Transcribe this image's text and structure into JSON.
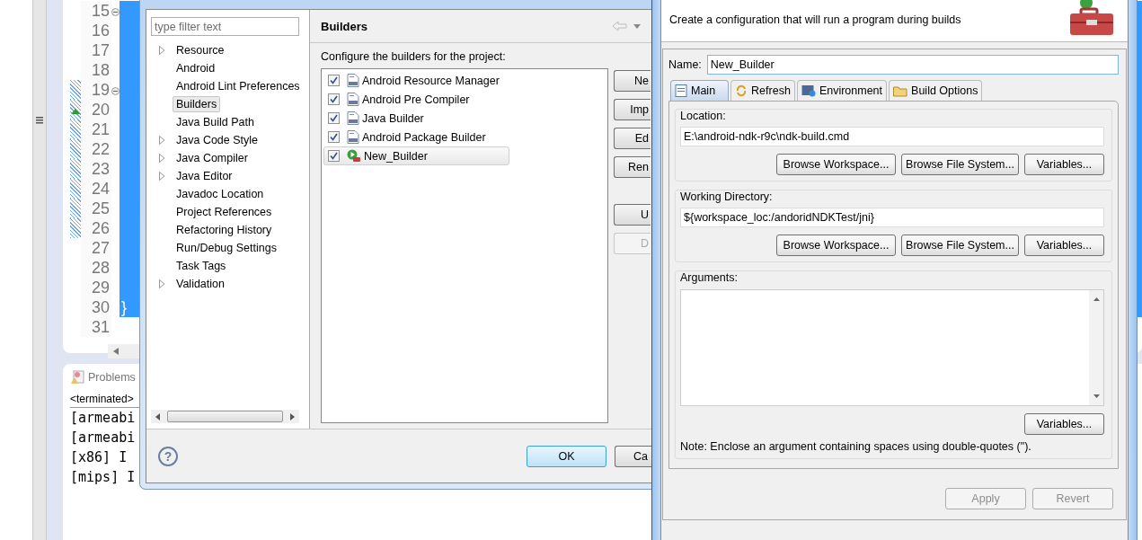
{
  "editor": {
    "lines": [
      {
        "number": "15",
        "kind": "fold",
        "selected": true,
        "changed": false
      },
      {
        "number": "16",
        "kind": "plain",
        "selected": true,
        "changed": false
      },
      {
        "number": "17",
        "kind": "plain",
        "selected": true,
        "changed": false
      },
      {
        "number": "18",
        "kind": "plain",
        "selected": true,
        "changed": false
      },
      {
        "number": "19",
        "kind": "fold",
        "selected": true,
        "changed": true
      },
      {
        "number": "20",
        "kind": "marker",
        "selected": true,
        "changed": true
      },
      {
        "number": "21",
        "kind": "plain",
        "selected": true,
        "changed": true
      },
      {
        "number": "22",
        "kind": "plain",
        "selected": true,
        "changed": true
      },
      {
        "number": "23",
        "kind": "plain",
        "selected": true,
        "changed": true
      },
      {
        "number": "24",
        "kind": "plain",
        "selected": true,
        "changed": true
      },
      {
        "number": "25",
        "kind": "plain",
        "selected": true,
        "changed": true
      },
      {
        "number": "26",
        "kind": "plain",
        "selected": true,
        "changed": true
      },
      {
        "number": "27",
        "kind": "plain",
        "selected": true,
        "changed": false
      },
      {
        "number": "28",
        "kind": "plain",
        "selected": true,
        "changed": false
      },
      {
        "number": "29",
        "kind": "plain",
        "selected": true,
        "changed": false
      },
      {
        "number": "30",
        "kind": "plain",
        "selected": true,
        "changed": false,
        "code": "}"
      },
      {
        "number": "31",
        "kind": "plain",
        "selected": false,
        "changed": false
      }
    ]
  },
  "console": {
    "tab": "Problems",
    "process": "<terminated>",
    "lines": [
      "[armeabi",
      "[armeabi",
      "[x86] I",
      "[mips] I"
    ]
  },
  "properties_dialog": {
    "filter": {
      "placeholder": "type filter text"
    },
    "tree": [
      {
        "label": "Resource",
        "expandable": true,
        "selected": false
      },
      {
        "label": "Android",
        "expandable": false,
        "selected": false
      },
      {
        "label": "Android Lint Preferences",
        "expandable": false,
        "selected": false
      },
      {
        "label": "Builders",
        "expandable": false,
        "selected": true
      },
      {
        "label": "Java Build Path",
        "expandable": false,
        "selected": false
      },
      {
        "label": "Java Code Style",
        "expandable": true,
        "selected": false
      },
      {
        "label": "Java Compiler",
        "expandable": true,
        "selected": false
      },
      {
        "label": "Java Editor",
        "expandable": true,
        "selected": false
      },
      {
        "label": "Javadoc Location",
        "expandable": false,
        "selected": false
      },
      {
        "label": "Project References",
        "expandable": false,
        "selected": false
      },
      {
        "label": "Refactoring History",
        "expandable": false,
        "selected": false
      },
      {
        "label": "Run/Debug Settings",
        "expandable": false,
        "selected": false
      },
      {
        "label": "Task Tags",
        "expandable": false,
        "selected": false
      },
      {
        "label": "Validation",
        "expandable": true,
        "selected": false
      }
    ],
    "page_title": "Builders",
    "description": "Configure the builders for the project:",
    "builders": [
      {
        "label": "Android Resource Manager",
        "kind": "builder",
        "checked": true,
        "selected": false
      },
      {
        "label": "Android Pre Compiler",
        "kind": "builder",
        "checked": true,
        "selected": false
      },
      {
        "label": "Java Builder",
        "kind": "builder",
        "checked": true,
        "selected": false
      },
      {
        "label": "Android Package Builder",
        "kind": "builder",
        "checked": true,
        "selected": false
      },
      {
        "label": "New_Builder",
        "kind": "program",
        "checked": true,
        "selected": true
      }
    ],
    "side_buttons": [
      {
        "label": "Ne",
        "disabled": false
      },
      {
        "label": "Imp",
        "disabled": false
      },
      {
        "label": "Ed",
        "disabled": false
      },
      {
        "label": "Ren",
        "disabled": false
      },
      {
        "label": "U",
        "disabled": false
      },
      {
        "label": "D",
        "disabled": true
      }
    ],
    "help": "?",
    "ok": "OK",
    "cancel": "Ca"
  },
  "launch_dialog": {
    "description": "Create a configuration that will run a program during builds",
    "name_label": "Name:",
    "name_value": "New_Builder",
    "tabs": [
      {
        "label": "Main",
        "selected": true
      },
      {
        "label": "Refresh",
        "selected": false
      },
      {
        "label": "Environment",
        "selected": false
      },
      {
        "label": "Build Options",
        "selected": false
      }
    ],
    "groups": [
      {
        "label": "Location:",
        "value": "E:\\android-ndk-r9c\\ndk-build.cmd",
        "buttons": [
          "Browse Workspace...",
          "Browse File System...",
          "Variables..."
        ]
      },
      {
        "label": "Working Directory:",
        "value": "${workspace_loc:/andoridNDKTest/jni}",
        "buttons": [
          "Browse Workspace...",
          "Browse File System...",
          "Variables..."
        ]
      }
    ],
    "arguments": {
      "label": "Arguments:",
      "button": "Variables...",
      "note": "Note: Enclose an argument containing spaces using double-quotes (\")."
    },
    "actions": [
      {
        "label": "Apply",
        "disabled": true
      },
      {
        "label": "Revert",
        "disabled": true
      }
    ]
  }
}
